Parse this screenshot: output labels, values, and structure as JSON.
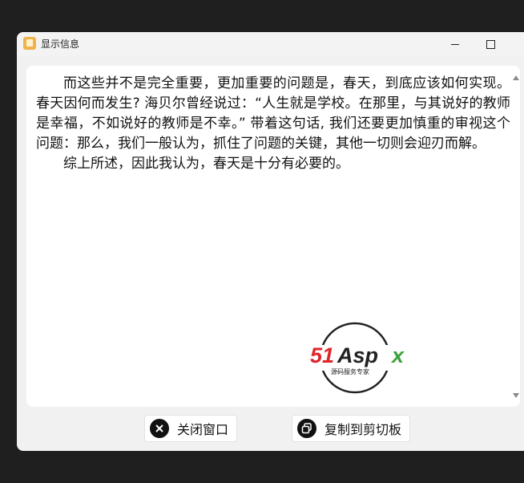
{
  "window": {
    "title": "显示信息",
    "minimize_label": "",
    "maximize_label": ""
  },
  "content": {
    "paragraphs": [
      "而这些并不是完全重要，更加重要的问题是，春天，到底应该如何实现。春天因何而发生? 海贝尔曾经说过：“人生就是学校。在那里，与其说好的教师是幸福，不如说好的教师是不幸。” 带着这句话, 我们还要更加慎重的审视这个问题：那么，我们一般认为，抓住了问题的关键，其他一切则会迎刃而解。",
      "综上所述，因此我认为，春天是十分有必要的。"
    ]
  },
  "logo": {
    "brand_text": "51Aspx",
    "tagline": "源码服务专家"
  },
  "buttons": {
    "close_label": "关闭窗口",
    "copy_label": "复制到剪切板"
  },
  "colors": {
    "logo_red": "#e0252b",
    "logo_green": "#3aa23a",
    "accent": "#f1b24a"
  },
  "icons": {
    "app": "app-icon",
    "close": "close-circle-icon",
    "copy": "copy-circle-icon"
  }
}
